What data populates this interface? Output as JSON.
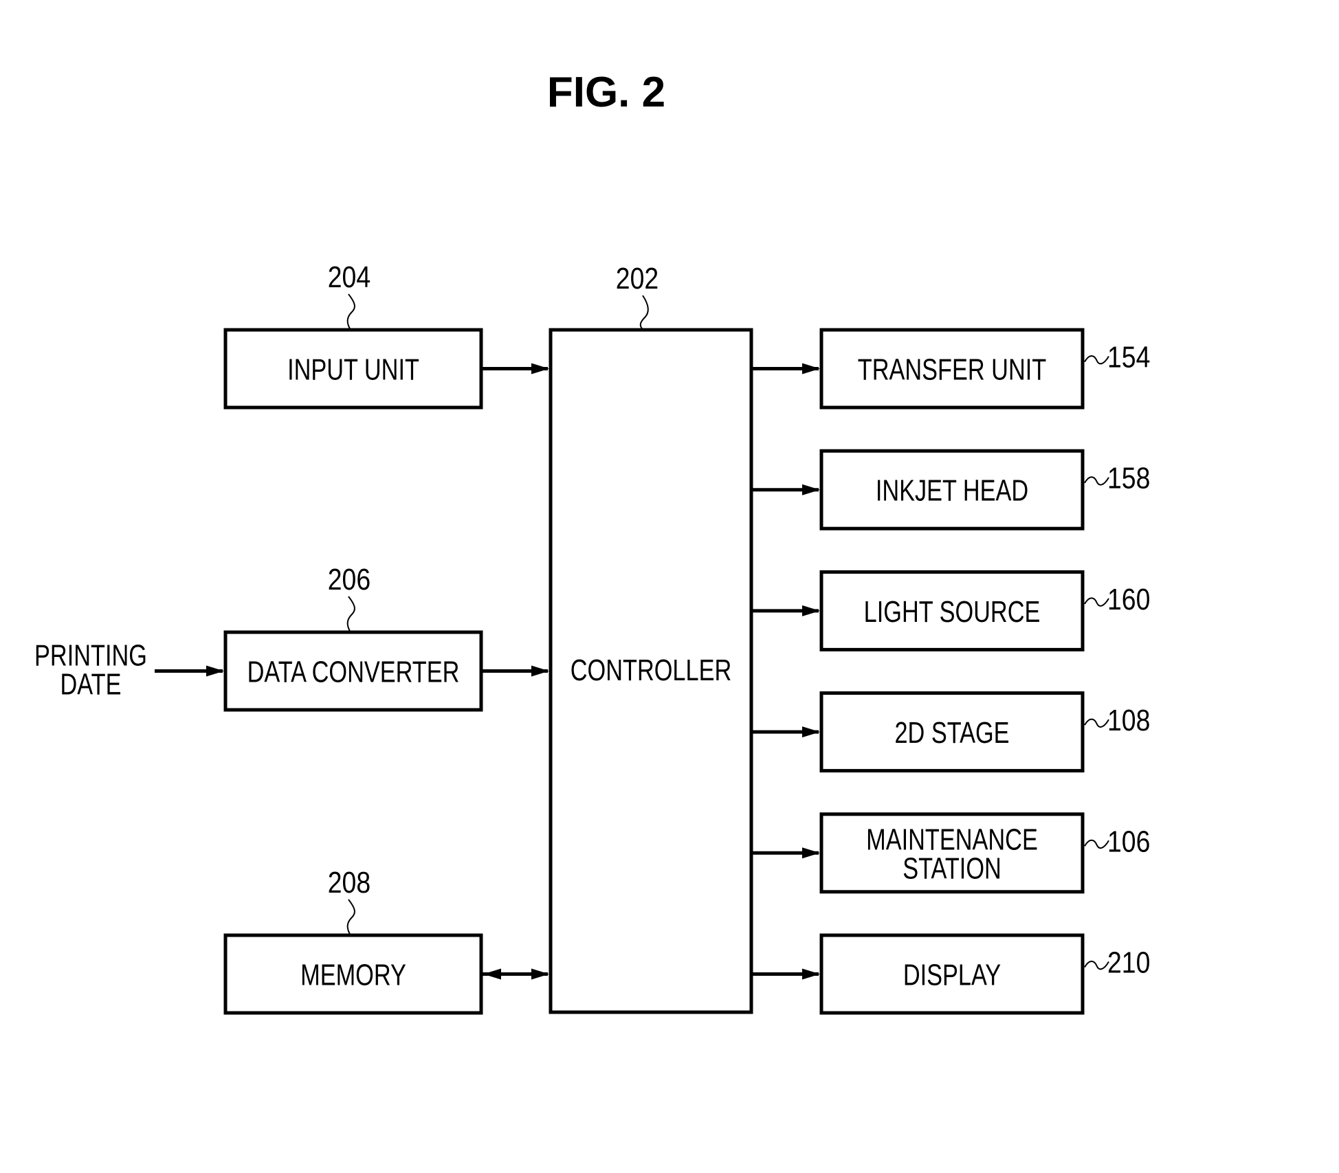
{
  "figure": {
    "title": "FIG. 2"
  },
  "controller": {
    "label": "CONTROLLER",
    "ref": "202"
  },
  "left_blocks": [
    {
      "id": "input-unit",
      "label": "INPUT UNIT",
      "ref": "204",
      "connection": "to-controller"
    },
    {
      "id": "data-converter",
      "label": "DATA CONVERTER",
      "ref": "206",
      "connection": "to-controller"
    },
    {
      "id": "memory",
      "label": "MEMORY",
      "ref": "208",
      "connection": "bidirectional"
    }
  ],
  "external_input": {
    "lines": [
      "PRINTING",
      "DATE"
    ],
    "target": "data-converter"
  },
  "right_blocks": [
    {
      "id": "transfer-unit",
      "lines": [
        "TRANSFER UNIT"
      ],
      "ref": "154"
    },
    {
      "id": "inkjet-head",
      "lines": [
        "INKJET HEAD"
      ],
      "ref": "158"
    },
    {
      "id": "light-source",
      "lines": [
        "LIGHT SOURCE"
      ],
      "ref": "160"
    },
    {
      "id": "2d-stage",
      "lines": [
        "2D STAGE"
      ],
      "ref": "108"
    },
    {
      "id": "maintenance-station",
      "lines": [
        "MAINTENANCE",
        "STATION"
      ],
      "ref": "106"
    },
    {
      "id": "display",
      "lines": [
        "DISPLAY"
      ],
      "ref": "210"
    }
  ]
}
